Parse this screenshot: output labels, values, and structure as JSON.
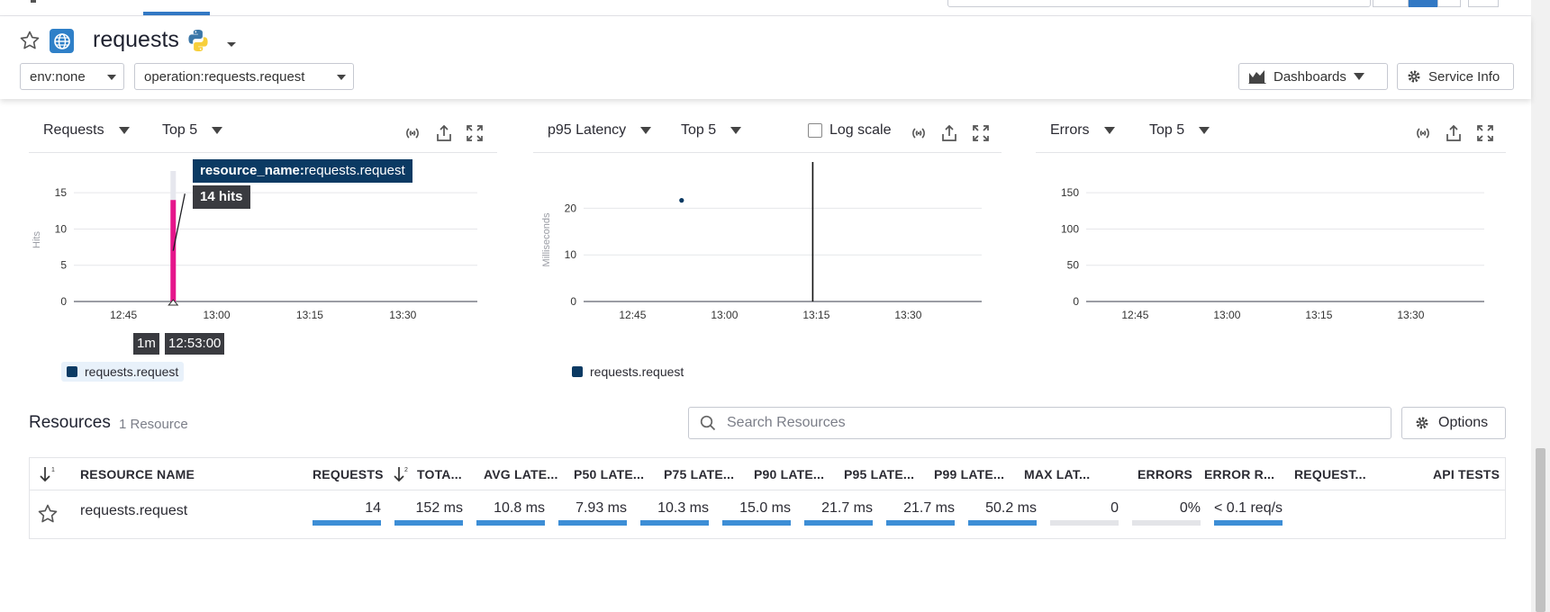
{
  "header": {
    "service_name": "requests",
    "filters": {
      "env": "env:none",
      "operation": "operation:requests.request"
    },
    "dashboards_label": "Dashboards",
    "service_info_label": "Service Info"
  },
  "widgets": [
    {
      "metric": "Requests",
      "topn": "Top 5",
      "legend": "requests.request",
      "ylabel": "Hits"
    },
    {
      "metric": "p95 Latency",
      "topn": "Top 5",
      "log_scale_label": "Log scale",
      "legend": "requests.request",
      "ylabel": "Milliseconds"
    },
    {
      "metric": "Errors",
      "topn": "Top 5"
    }
  ],
  "tooltip": {
    "key": "resource_name:",
    "value": "requests.request",
    "hits": "14 hits",
    "interval": "1m",
    "time": "12:53:00"
  },
  "chart_data": [
    {
      "type": "bar",
      "ylabel": "Hits",
      "x_ticks": [
        "12:45",
        "13:00",
        "13:15",
        "13:30"
      ],
      "y_ticks": [
        0,
        5,
        10,
        15
      ],
      "ylim": [
        0,
        18
      ],
      "series": [
        {
          "name": "requests.request",
          "points": [
            {
              "x": "12:53",
              "y": 14
            }
          ]
        }
      ],
      "grid": true
    },
    {
      "type": "scatter",
      "ylabel": "Milliseconds",
      "x_ticks": [
        "12:45",
        "13:00",
        "13:15",
        "13:30"
      ],
      "y_ticks": [
        0,
        10,
        20
      ],
      "ylim": [
        0,
        28
      ],
      "series": [
        {
          "name": "requests.request",
          "points": [
            {
              "x": "12:53",
              "y": 21.7
            }
          ]
        }
      ],
      "grid": true
    },
    {
      "type": "line",
      "x_ticks": [
        "12:45",
        "13:00",
        "13:15",
        "13:30"
      ],
      "y_ticks": [
        0,
        50,
        100,
        150
      ],
      "ylim": [
        0,
        180
      ],
      "series": [],
      "grid": true
    }
  ],
  "resources": {
    "title": "Resources",
    "count": "1 Resource",
    "search_placeholder": "Search Resources",
    "options_label": "Options",
    "columns": [
      "RESOURCE NAME",
      "REQUESTS",
      "TOTA...",
      "AVG LATE...",
      "P50 LATE...",
      "P75 LATE...",
      "P90 LATE...",
      "P95 LATE...",
      "P99 LATE...",
      "MAX LAT...",
      "ERRORS",
      "ERROR R...",
      "REQUEST...",
      "API TESTS"
    ],
    "row": {
      "name": "requests.request",
      "values": [
        "14",
        "152 ms",
        "10.8 ms",
        "7.93 ms",
        "10.3 ms",
        "15.0 ms",
        "21.7 ms",
        "21.7 ms",
        "50.2 ms",
        "0",
        "0%",
        "< 0.1 req/s"
      ],
      "bar_fill": [
        1,
        1,
        1,
        1,
        1,
        1,
        1,
        1,
        1,
        0,
        0,
        1
      ]
    }
  },
  "colors": {
    "accent": "#3278c4",
    "series": "#0b3a63",
    "highlight_bar": "#e5168b",
    "table_bar": "#3d8ed6"
  }
}
